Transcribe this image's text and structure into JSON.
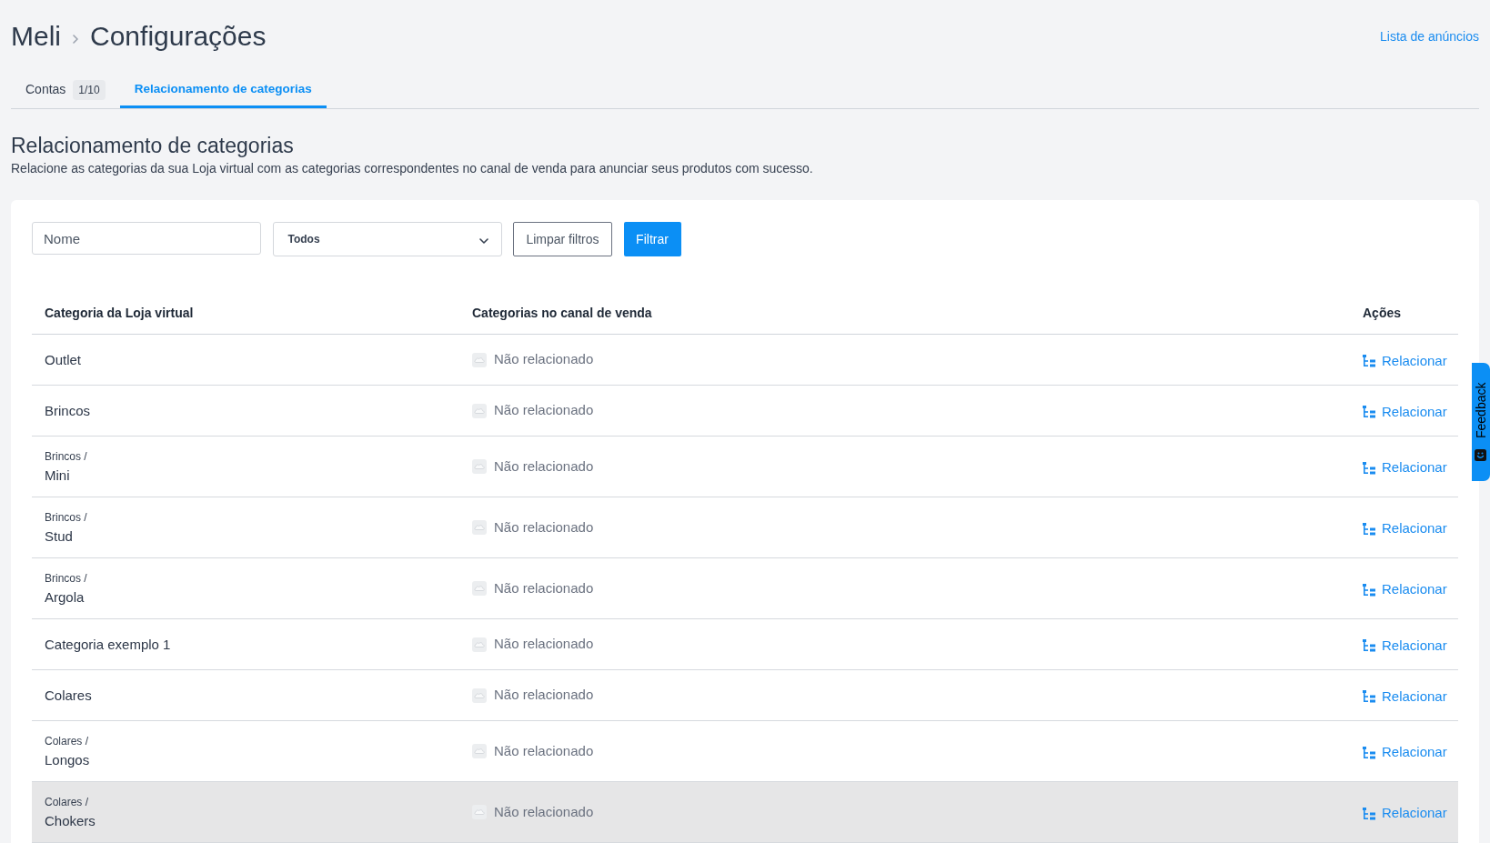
{
  "header": {
    "breadcrumb": [
      {
        "label": "Meli"
      },
      {
        "label": "Configurações"
      }
    ],
    "link": "Lista de anúncios"
  },
  "tabs": [
    {
      "label": "Contas",
      "badge": "1/10",
      "selected": false
    },
    {
      "label": "Relacionamento de categorias",
      "selected": true
    }
  ],
  "section": {
    "title": "Relacionamento de categorias",
    "description": "Relacione as categorias da sua Loja virtual com as categorias correspondentes no canal de venda para anunciar seus produtos com sucesso."
  },
  "filters": {
    "name_field": {
      "placeholder": "Nome"
    },
    "status_select": {
      "value": "Todos"
    },
    "buttons": [
      {
        "label": "Limpar filtros",
        "kind": "outline"
      },
      {
        "label": "Filtrar",
        "kind": "primary"
      }
    ]
  },
  "table": {
    "columns": [
      "Categoria da Loja virtual",
      "Categorias no canal de venda",
      "Ações"
    ],
    "rows": [
      {
        "name": "Outlet",
        "status": "Não relacionado",
        "action": "Relacionar",
        "highlighted": false
      },
      {
        "name": "Brincos",
        "status": "Não relacionado",
        "action": "Relacionar",
        "highlighted": false
      },
      {
        "parent": "Brincos /",
        "name": "Mini",
        "status": "Não relacionado",
        "action": "Relacionar",
        "highlighted": false
      },
      {
        "parent": "Brincos /",
        "name": "Stud",
        "status": "Não relacionado",
        "action": "Relacionar",
        "highlighted": false
      },
      {
        "parent": "Brincos /",
        "name": "Argola",
        "status": "Não relacionado",
        "action": "Relacionar",
        "highlighted": false
      },
      {
        "name": "Categoria exemplo 1",
        "status": "Não relacionado",
        "action": "Relacionar",
        "highlighted": false
      },
      {
        "name": "Colares",
        "status": "Não relacionado",
        "action": "Relacionar",
        "highlighted": false
      },
      {
        "parent": "Colares /",
        "name": "Longos",
        "status": "Não relacionado",
        "action": "Relacionar",
        "highlighted": false
      },
      {
        "parent": "Colares /",
        "name": "Chokers",
        "status": "Não relacionado",
        "action": "Relacionar",
        "highlighted": true
      }
    ]
  },
  "feedback_tab": {
    "label": "Feedback"
  }
}
